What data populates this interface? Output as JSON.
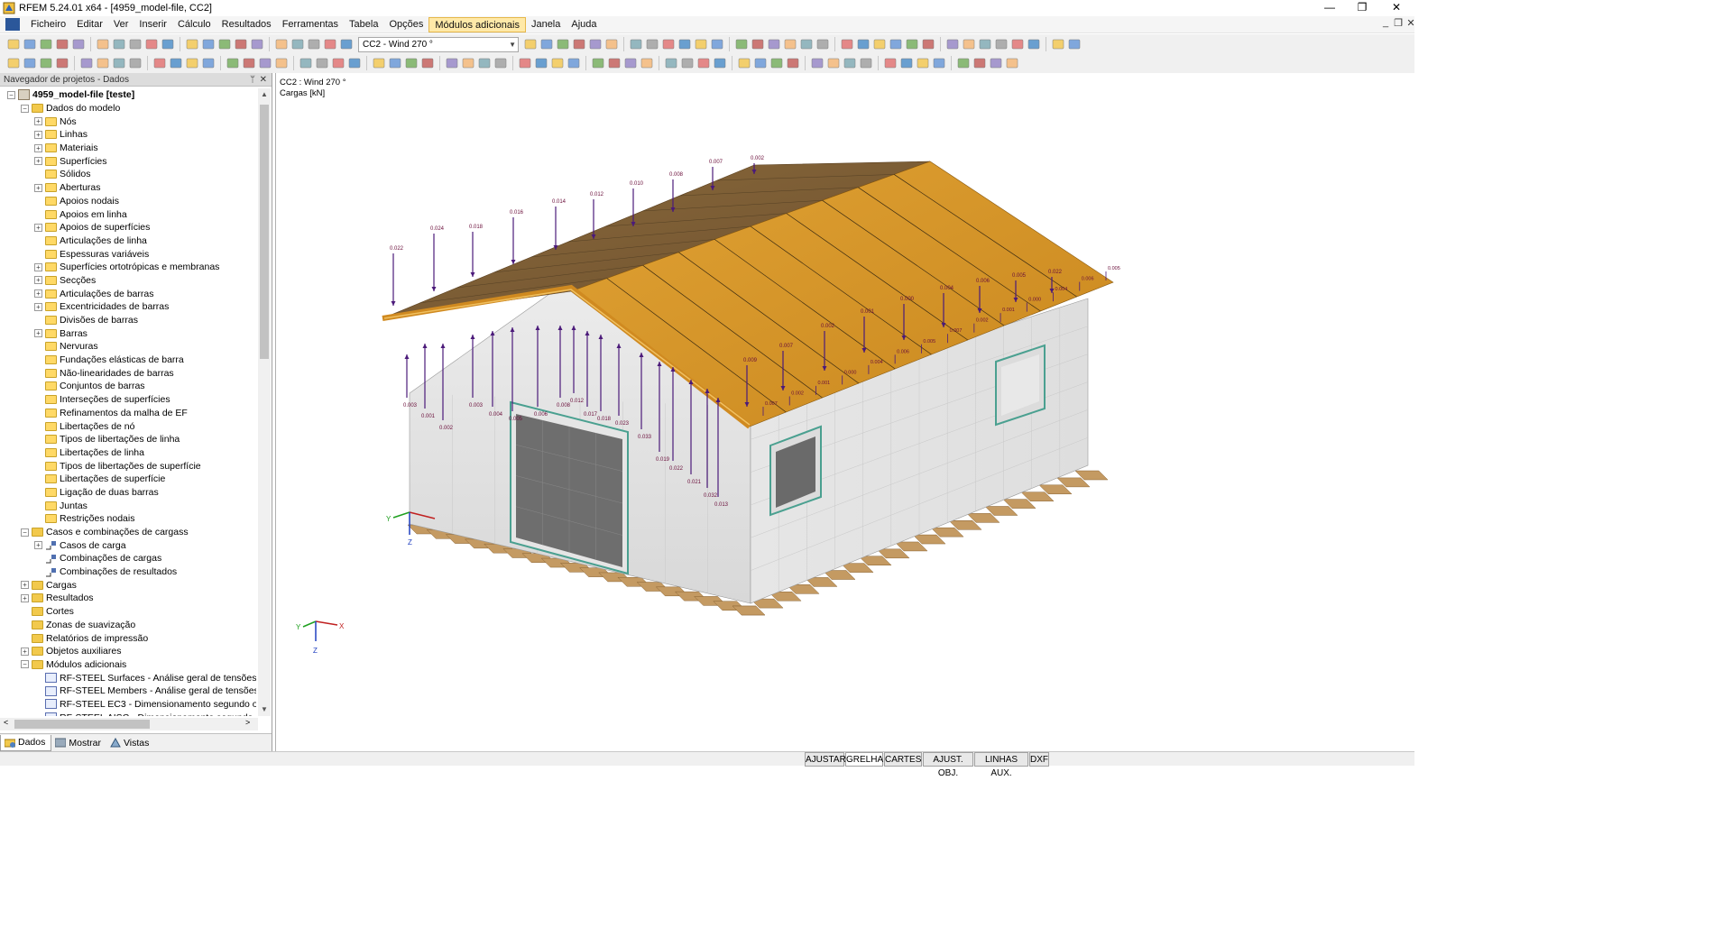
{
  "window": {
    "title": "RFEM 5.24.01 x64 - [4959_model-file, CC2]",
    "controls": {
      "minimize": "—",
      "maximize": "❐",
      "close": "✕"
    },
    "mdi_controls": {
      "minimize": "_",
      "restore": "❐",
      "close": "✕"
    }
  },
  "menu": [
    "Ficheiro",
    "Editar",
    "Ver",
    "Inserir",
    "Cálculo",
    "Resultados",
    "Ferramentas",
    "Tabela",
    "Opções",
    "Módulos adicionais",
    "Janela",
    "Ajuda"
  ],
  "menu_active": "Módulos adicionais",
  "toolbar": {
    "load_case_combo": "CC2 - Wind 270 °"
  },
  "navigator": {
    "title": "Navegador de projetos - Dados",
    "pin": "ᛘ",
    "close": "✕",
    "root": "4959_model-file [teste]",
    "model_data": "Dados do modelo",
    "model_items": [
      {
        "label": "Nós",
        "exp": true
      },
      {
        "label": "Linhas",
        "exp": true
      },
      {
        "label": "Materiais",
        "exp": true
      },
      {
        "label": "Superfícies",
        "exp": true
      },
      {
        "label": "Sólidos",
        "exp": false
      },
      {
        "label": "Aberturas",
        "exp": true
      },
      {
        "label": "Apoios nodais",
        "exp": false
      },
      {
        "label": "Apoios em linha",
        "exp": false
      },
      {
        "label": "Apoios de superfícies",
        "exp": true
      },
      {
        "label": "Articulações de linha",
        "exp": false
      },
      {
        "label": "Espessuras variáveis",
        "exp": false
      },
      {
        "label": "Superfícies ortotrópicas e membranas",
        "exp": true
      },
      {
        "label": "Secções",
        "exp": true
      },
      {
        "label": "Articulações de barras",
        "exp": true
      },
      {
        "label": "Excentricidades de barras",
        "exp": true
      },
      {
        "label": "Divisões de barras",
        "exp": false
      },
      {
        "label": "Barras",
        "exp": true
      },
      {
        "label": "Nervuras",
        "exp": false
      },
      {
        "label": "Fundações elásticas de barra",
        "exp": false
      },
      {
        "label": "Não-linearidades de barras",
        "exp": false
      },
      {
        "label": "Conjuntos de barras",
        "exp": false
      },
      {
        "label": "Interseções de superfícies",
        "exp": false
      },
      {
        "label": "Refinamentos da malha de EF",
        "exp": false
      },
      {
        "label": "Libertações de nó",
        "exp": false
      },
      {
        "label": "Tipos de libertações de linha",
        "exp": false
      },
      {
        "label": "Libertações de linha",
        "exp": false
      },
      {
        "label": "Tipos de libertações de superfície",
        "exp": false
      },
      {
        "label": "Libertações de superfície",
        "exp": false
      },
      {
        "label": "Ligação de duas barras",
        "exp": false
      },
      {
        "label": "Juntas",
        "exp": false
      },
      {
        "label": "Restrições nodais",
        "exp": false
      }
    ],
    "load_cases": "Casos e combinações de cargass",
    "load_items": [
      "Casos de carga",
      "Combinações de cargas",
      "Combinações de resultados"
    ],
    "top_items": [
      {
        "label": "Cargas",
        "exp": true
      },
      {
        "label": "Resultados",
        "exp": true
      },
      {
        "label": "Cortes",
        "exp": false
      },
      {
        "label": "Zonas de suavização",
        "exp": false
      },
      {
        "label": "Relatórios de impressão",
        "exp": false
      },
      {
        "label": "Objetos auxiliares",
        "exp": true
      }
    ],
    "addons": "Módulos adicionais",
    "addon_items": [
      "RF-STEEL Surfaces - Análise geral de tensões de su",
      "RF-STEEL Members - Análise geral de tensões de b",
      "RF-STEEL EC3 - Dimensionamento segundo o Eurc",
      "RF-STEEL AISC - Dimensionamento segundo a"
    ],
    "tabs": [
      "Dados",
      "Mostrar",
      "Vistas"
    ]
  },
  "viewport": {
    "line1": "CC2 : Wind 270 °",
    "line2": "Cargas [kN]",
    "axes": {
      "x": "X",
      "y": "Y",
      "z": "Z"
    },
    "load_labels": [
      "0.022",
      "0.024",
      "0.018",
      "0.016",
      "0.014",
      "0.012",
      "0.010",
      "0.008",
      "0.007",
      "0.002",
      "0.003",
      "0.001",
      "0.002",
      "0.003",
      "0.004",
      "0.005",
      "0.006",
      "0.008",
      "0.012",
      "0.017",
      "0.018",
      "0.023",
      "0.033",
      "0.019",
      "0.022",
      "0.021",
      "0.032",
      "0.013",
      "0.009",
      "0.007",
      "0.002",
      "0.001",
      "0.000",
      "0.004",
      "0.006",
      "0.005"
    ]
  },
  "status": [
    "AJUSTAR",
    "GRELHA",
    "CARTES",
    "AJUST. OBJ.",
    "LINHAS AUX.",
    "DXF"
  ],
  "status_on": [
    "GRELHA"
  ],
  "colors": {
    "roof": "#d99a2b",
    "wall": "#e3e3e3",
    "load_arrow": "#4b1a7a",
    "load_text": "#6a0e3a",
    "foundation": "#b98c56"
  }
}
